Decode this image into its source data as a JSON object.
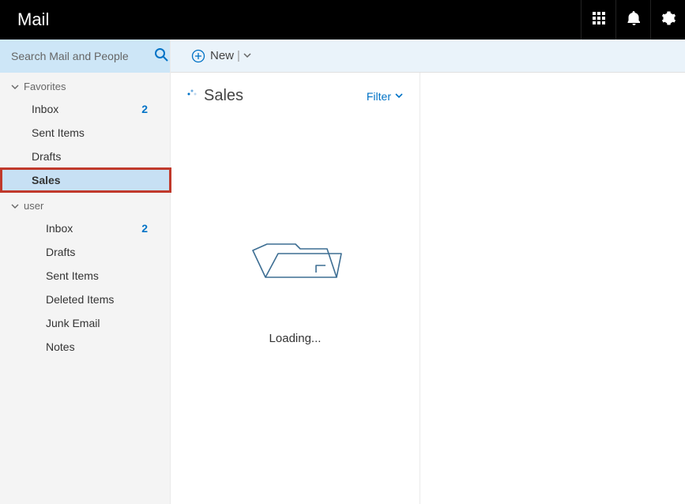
{
  "header": {
    "app_title": "Mail"
  },
  "search": {
    "placeholder": "Search Mail and People"
  },
  "toolbar": {
    "new_label": "New"
  },
  "sidebar": {
    "sections": [
      {
        "label": "Favorites",
        "folders": [
          {
            "label": "Inbox",
            "badge": "2"
          },
          {
            "label": "Sent Items",
            "badge": ""
          },
          {
            "label": "Drafts",
            "badge": ""
          },
          {
            "label": "Sales",
            "badge": "",
            "selected": true
          }
        ]
      },
      {
        "label": "user",
        "folders": [
          {
            "label": "Inbox",
            "badge": "2"
          },
          {
            "label": "Drafts",
            "badge": ""
          },
          {
            "label": "Sent Items",
            "badge": ""
          },
          {
            "label": "Deleted Items",
            "badge": ""
          },
          {
            "label": "Junk Email",
            "badge": ""
          },
          {
            "label": "Notes",
            "badge": ""
          }
        ]
      }
    ]
  },
  "listpane": {
    "title": "Sales",
    "filter_label": "Filter",
    "loading_label": "Loading..."
  }
}
